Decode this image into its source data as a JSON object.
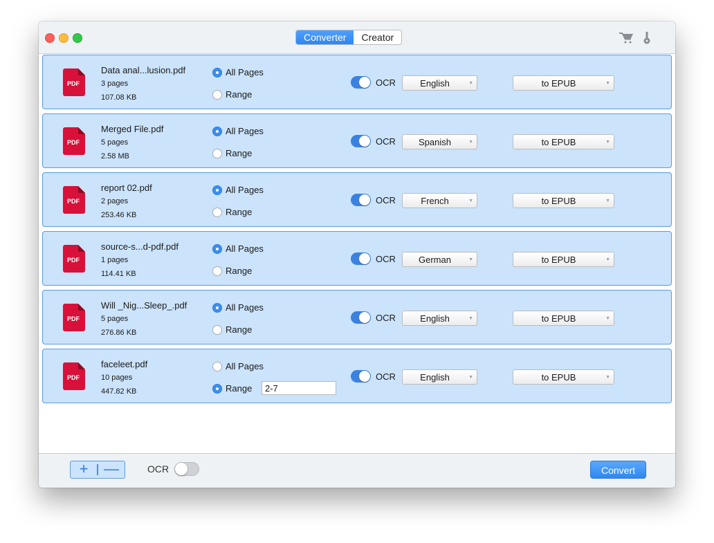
{
  "titlebar": {
    "tabs": [
      {
        "label": "Converter",
        "active": true
      },
      {
        "label": "Creator",
        "active": false
      }
    ],
    "icons": [
      "cart-icon",
      "key-icon"
    ]
  },
  "files": [
    {
      "name": "Data anal...lusion.pdf",
      "pages": "3 pages",
      "size": "107.08 KB",
      "all_pages_label": "All Pages",
      "range_label": "Range",
      "mode": "all",
      "range_value": "",
      "ocr_label": "OCR",
      "ocr_on": true,
      "language": "English",
      "format": "to EPUB",
      "icon_label": "PDF"
    },
    {
      "name": "Merged File.pdf",
      "pages": "5 pages",
      "size": "2.58 MB",
      "all_pages_label": "All Pages",
      "range_label": "Range",
      "mode": "all",
      "range_value": "",
      "ocr_label": "OCR",
      "ocr_on": true,
      "language": "Spanish",
      "format": "to EPUB",
      "icon_label": "PDF"
    },
    {
      "name": "report 02.pdf",
      "pages": "2 pages",
      "size": "253.46 KB",
      "all_pages_label": "All Pages",
      "range_label": "Range",
      "mode": "all",
      "range_value": "",
      "ocr_label": "OCR",
      "ocr_on": true,
      "language": "French",
      "format": "to EPUB",
      "icon_label": "PDF"
    },
    {
      "name": "source-s...d-pdf.pdf",
      "pages": "1 pages",
      "size": "114.41 KB",
      "all_pages_label": "All Pages",
      "range_label": "Range",
      "mode": "all",
      "range_value": "",
      "ocr_label": "OCR",
      "ocr_on": true,
      "language": "German",
      "format": "to EPUB",
      "icon_label": "PDF"
    },
    {
      "name": "Will _Nig...Sleep_.pdf",
      "pages": "5 pages",
      "size": "276.86 KB",
      "all_pages_label": "All Pages",
      "range_label": "Range",
      "mode": "all",
      "range_value": "",
      "ocr_label": "OCR",
      "ocr_on": true,
      "language": "English",
      "format": "to EPUB",
      "icon_label": "PDF"
    },
    {
      "name": "faceleet.pdf",
      "pages": "10 pages",
      "size": "447.82 KB",
      "all_pages_label": "All Pages",
      "range_label": "Range",
      "mode": "range",
      "range_value": "2-7",
      "ocr_label": "OCR",
      "ocr_on": true,
      "language": "English",
      "format": "to EPUB",
      "icon_label": "PDF"
    }
  ],
  "footer": {
    "add_label": "+",
    "remove_label": "—",
    "ocr_label": "OCR",
    "ocr_on": false,
    "convert_label": "Convert"
  },
  "colors": {
    "accent": "#2e88f2",
    "row_bg": "#cbe3fb",
    "row_border": "#5a9be6",
    "pdf_red": "#d8113a"
  }
}
